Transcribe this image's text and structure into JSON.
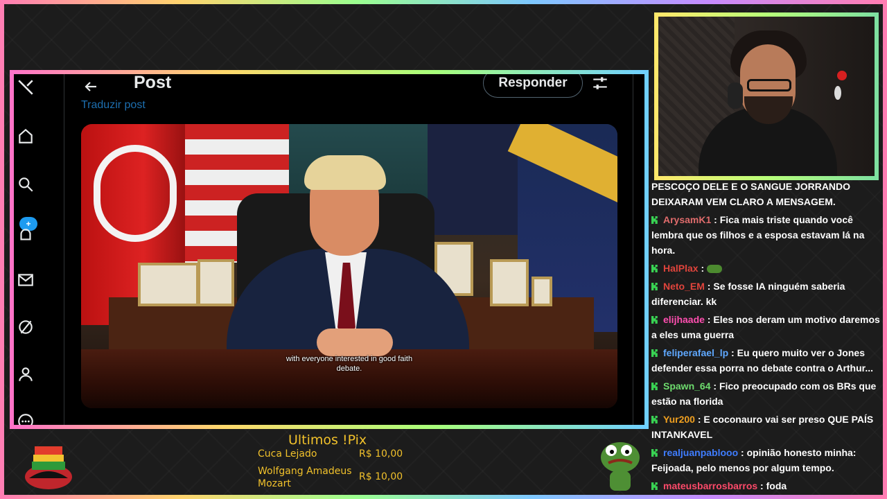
{
  "x_post": {
    "title": "Post",
    "reply_label": "Responder",
    "translate_label": "Traduzir post",
    "compose_badge": "+",
    "subtitle_line1": "with everyone interested in good faith",
    "subtitle_line2": "debate."
  },
  "sidebar_icons": [
    "x-logo-icon",
    "home-icon",
    "search-icon",
    "notifications-icon",
    "messages-icon",
    "grok-icon",
    "profile-icon",
    "more-icon"
  ],
  "chat": {
    "partial_top": "PESCOÇO DELE E O SANGUE JORRANDO DEIXARAM VEM CLARO A MENSAGEM.",
    "messages": [
      {
        "user": "ArysamK1",
        "color": "#e06c6c",
        "text": "Fica mais triste quando você lembra que os filhos e a esposa estavam lá na hora."
      },
      {
        "user": "HalPlax",
        "color": "#e0443c",
        "text": ""
      },
      {
        "user": "Neto_EM",
        "color": "#e0443c",
        "text": "Se fosse IA ninguém saberia diferenciar. kk"
      },
      {
        "user": "elijhaade",
        "color": "#ff4fb0",
        "text": "Eles nos deram um motivo daremos a eles uma guerra"
      },
      {
        "user": "feliperafael_lp",
        "color": "#5fa8ff",
        "text": "Eu quero muito ver o Jones defender essa porra no debate contra o Arthur..."
      },
      {
        "user": "Spawn_64",
        "color": "#6edc6e",
        "text": "Fico preocupado com os BRs que estão na florida"
      },
      {
        "user": "Yur200",
        "color": "#f0a020",
        "text": "E coconauro vai ser preso QUE PAÍS INTANKAVEL"
      },
      {
        "user": "realjuanpablooo",
        "color": "#3f7dff",
        "text": "opinião honesto minha: Feijoada, pelo menos por algum tempo."
      },
      {
        "user": "mateusbarrosbarros",
        "color": "#ff4a6a",
        "text": "foda"
      }
    ]
  },
  "pix": {
    "title": "Ultimos !Pix",
    "entries": [
      {
        "name": "Cuca Lejado",
        "amount": "R$ 10,00"
      },
      {
        "name": "Wolfgang Amadeus Mozart",
        "amount": "R$ 10,00"
      }
    ]
  },
  "colors": {
    "accent": "#1d9bf0",
    "pix": "#f1c12b",
    "badge": "#39d353"
  }
}
